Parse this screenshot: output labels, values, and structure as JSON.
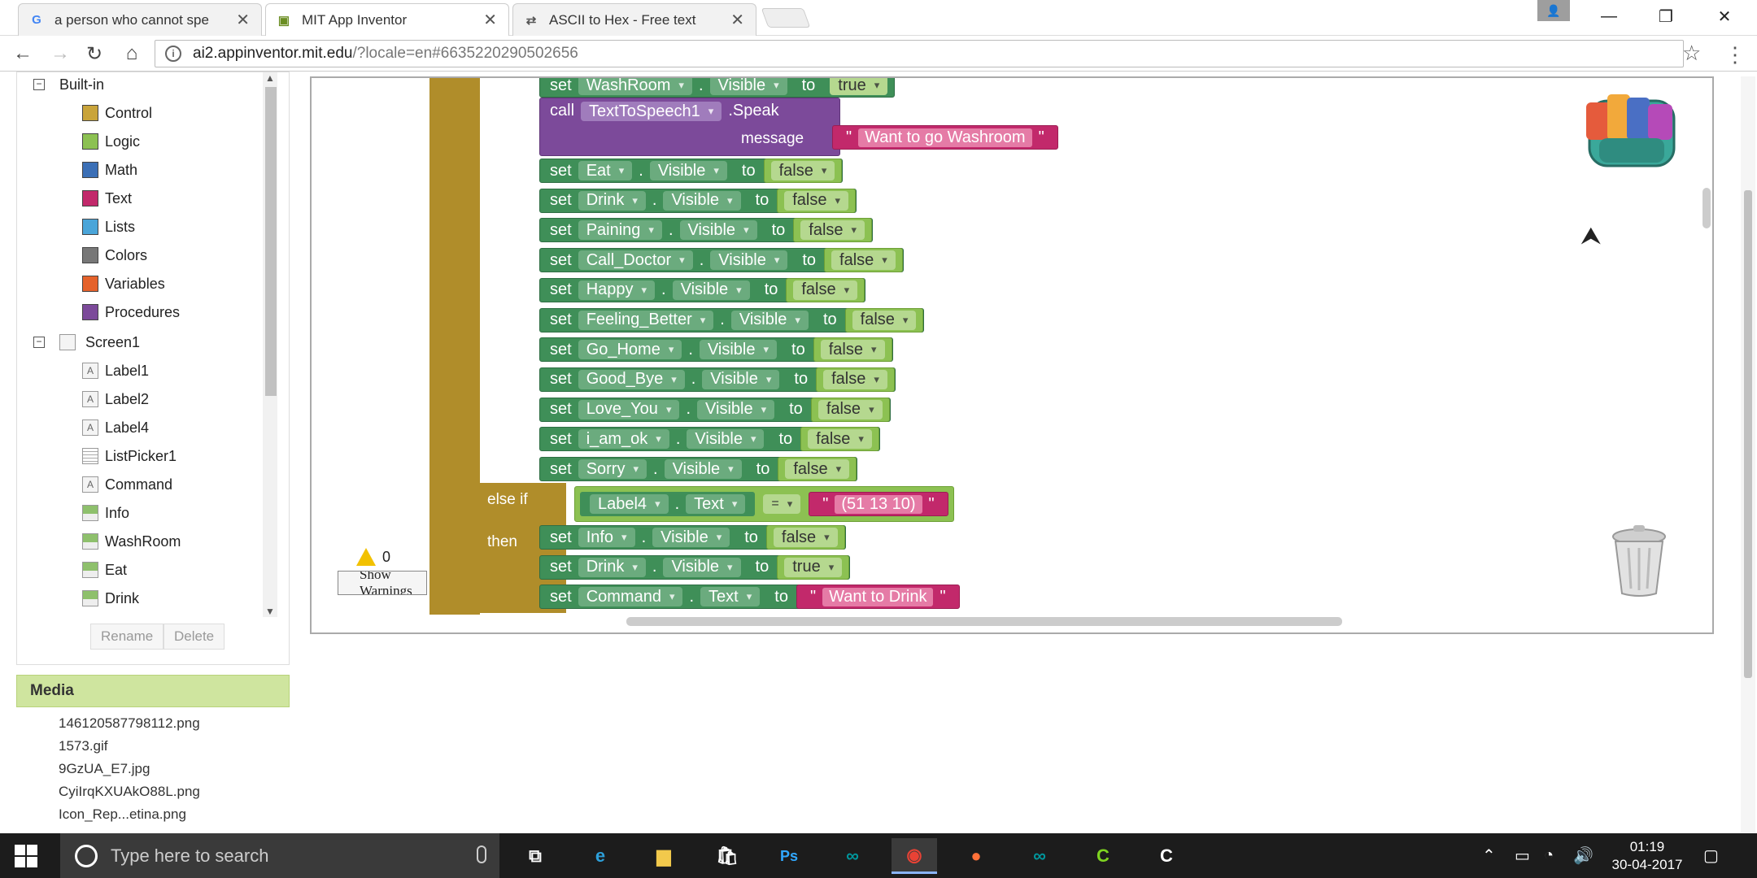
{
  "browser": {
    "tabs": [
      {
        "label": "a person who cannot spe",
        "favicon": "google-icon"
      },
      {
        "label": "MIT App Inventor",
        "favicon": "app-inventor-icon"
      },
      {
        "label": "ASCII to Hex - Free text",
        "favicon": "converter-icon"
      }
    ],
    "url_domain": "ai2.appinventor.mit.edu",
    "url_path": "/?locale=en#6635220290502656"
  },
  "tree": {
    "builtin_label": "Built-in",
    "builtin_items": [
      {
        "label": "Control",
        "color": "#c9a43a"
      },
      {
        "label": "Logic",
        "color": "#8cc152"
      },
      {
        "label": "Math",
        "color": "#3b6fb6"
      },
      {
        "label": "Text",
        "color": "#c2296b"
      },
      {
        "label": "Lists",
        "color": "#4aa5d9"
      },
      {
        "label": "Colors",
        "color": "#777777"
      },
      {
        "label": "Variables",
        "color": "#e5622b"
      },
      {
        "label": "Procedures",
        "color": "#7c4a9a"
      }
    ],
    "screen_label": "Screen1",
    "components": [
      {
        "label": "Label1",
        "icon": "A"
      },
      {
        "label": "Label2",
        "icon": "A"
      },
      {
        "label": "Label4",
        "icon": "A"
      },
      {
        "label": "ListPicker1",
        "icon": "list"
      },
      {
        "label": "Command",
        "icon": "A"
      },
      {
        "label": "Info",
        "icon": "img"
      },
      {
        "label": "WashRoom",
        "icon": "img"
      },
      {
        "label": "Eat",
        "icon": "img"
      },
      {
        "label": "Drink",
        "icon": "img"
      }
    ],
    "rename_label": "Rename",
    "delete_label": "Delete"
  },
  "media": {
    "title": "Media",
    "files": [
      "146120587798112.png",
      "1573.gif",
      "9GzUA_E7.jpg",
      "CyiIrqKXUAkO88L.png",
      "Icon_Rep...etina.png"
    ]
  },
  "blocks": {
    "kw_set": "set",
    "kw_to": "to",
    "kw_call": "call",
    "kw_visible": "Visible",
    "kw_text": "Text",
    "kw_else_if": "else if",
    "kw_then": "then",
    "top_set": {
      "component": "WashRoom",
      "value": "true"
    },
    "call": {
      "component": "TextToSpeech1",
      "method": ".Speak",
      "param": "message",
      "value": "Want to go Washroom"
    },
    "set_false_rows": [
      {
        "component": "Eat",
        "value": "false"
      },
      {
        "component": "Drink",
        "value": "false"
      },
      {
        "component": "Paining",
        "value": "false"
      },
      {
        "component": "Call_Doctor",
        "value": "false"
      },
      {
        "component": "Happy",
        "value": "false"
      },
      {
        "component": "Feeling_Better",
        "value": "false"
      },
      {
        "component": "Go_Home",
        "value": "false"
      },
      {
        "component": "Good_Bye",
        "value": "false"
      },
      {
        "component": "Love_You",
        "value": "false"
      },
      {
        "component": "i_am_ok",
        "value": "false"
      },
      {
        "component": "Sorry",
        "value": "false"
      }
    ],
    "condition": {
      "component": "Label4",
      "property": "Text",
      "op": "=",
      "value": "(51 13 10)"
    },
    "then_rows": [
      {
        "component": "Info",
        "property": "Visible",
        "value": "false"
      },
      {
        "component": "Drink",
        "property": "Visible",
        "value": "true"
      },
      {
        "component": "Command",
        "property": "Text",
        "value": "Want to Drink"
      }
    ],
    "warnings_count": "0",
    "show_warnings_label": "Show Warnings"
  },
  "taskbar": {
    "search_placeholder": "Type here to search",
    "time": "01:19",
    "date": "30-04-2017"
  }
}
